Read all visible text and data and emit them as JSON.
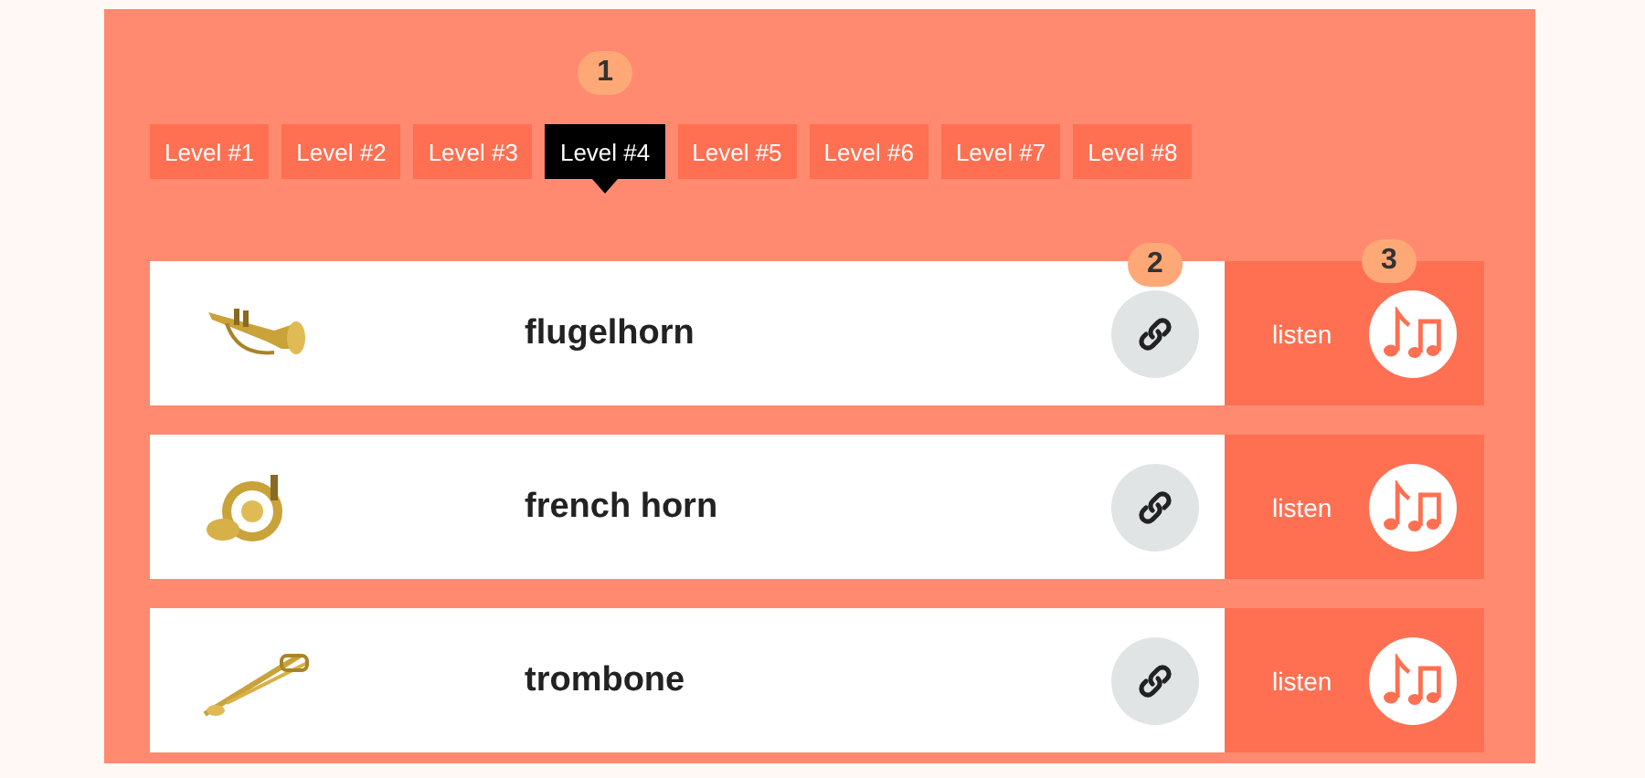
{
  "tabs": [
    {
      "label": "Level #1",
      "selected": false
    },
    {
      "label": "Level #2",
      "selected": false
    },
    {
      "label": "Level #3",
      "selected": false
    },
    {
      "label": "Level #4",
      "selected": true,
      "callout": "1"
    },
    {
      "label": "Level #5",
      "selected": false
    },
    {
      "label": "Level #6",
      "selected": false
    },
    {
      "label": "Level #7",
      "selected": false
    },
    {
      "label": "Level #8",
      "selected": false
    }
  ],
  "instruments": [
    {
      "name": "flugelhorn",
      "listen": "listen",
      "link_callout": "2",
      "listen_callout": "3"
    },
    {
      "name": "french horn",
      "listen": "listen"
    },
    {
      "name": "trombone",
      "listen": "listen"
    }
  ]
}
